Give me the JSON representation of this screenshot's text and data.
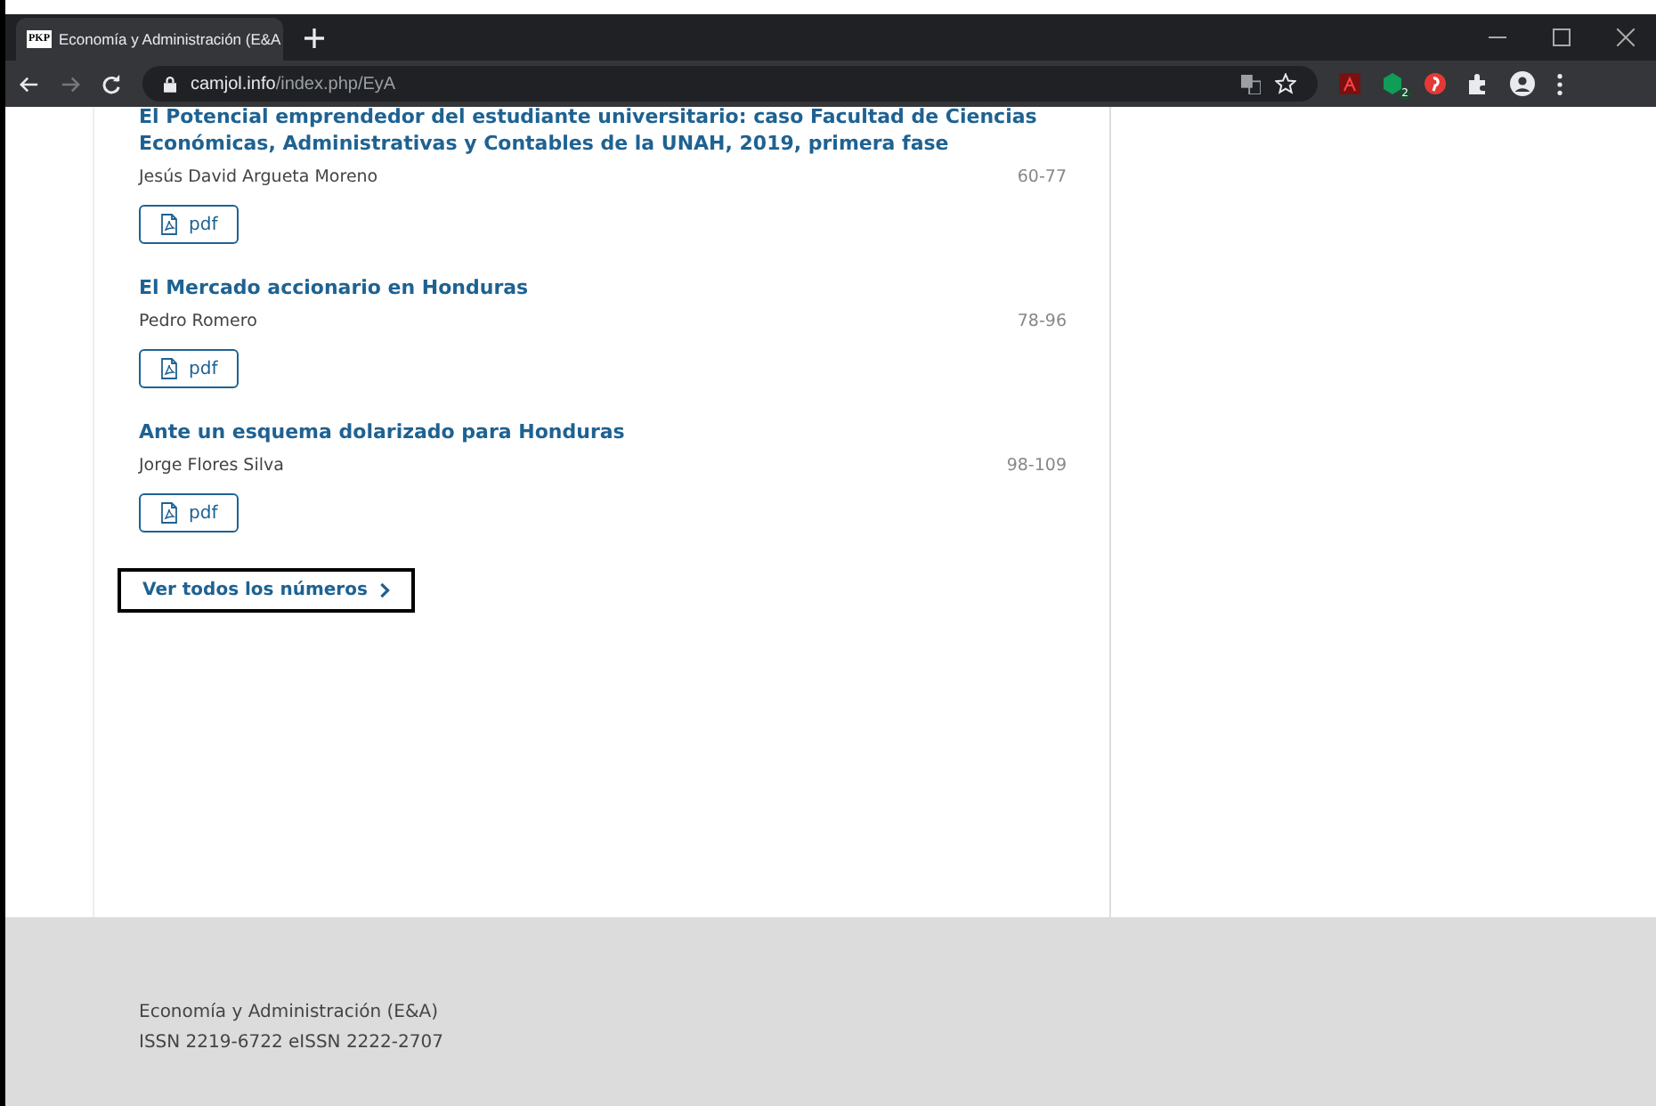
{
  "browser": {
    "tab_title": "Economía y Administración (E&A",
    "favicon_text": "PKP",
    "url_host": "camjol.info",
    "url_path": "/index.php/EyA",
    "extension_badge": "2"
  },
  "articles": [
    {
      "title": "El Potencial emprendedor del estudiante universitario: caso Facultad de Ciencias Económicas, Administrativas y Contables de la UNAH, 2019, primera fase",
      "author": "Jesús David Argueta Moreno",
      "pages": "60-77",
      "galley": "pdf"
    },
    {
      "title": "El Mercado accionario en Honduras",
      "author": "Pedro Romero",
      "pages": "78-96",
      "galley": "pdf"
    },
    {
      "title": "Ante un esquema dolarizado para Honduras",
      "author": "Jorge Flores Silva",
      "pages": "98-109",
      "galley": "pdf"
    }
  ],
  "view_all": {
    "label": "Ver todos los números",
    "focused": true
  },
  "footer": {
    "lines": [
      "Economía y Administración (E&A)",
      "ISSN 2219-6722 eISSN 2222-2707"
    ]
  }
}
